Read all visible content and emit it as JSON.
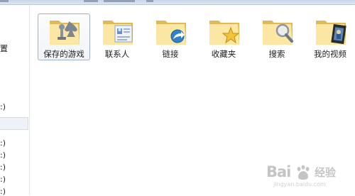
{
  "navigation": {
    "items": [
      "置",
      ":)",
      ":)",
      ":)",
      ":)",
      ":)",
      ":)"
    ]
  },
  "folders": [
    {
      "label": "保存的游戏",
      "icon": "saved-games-folder-icon",
      "selected": true
    },
    {
      "label": "联系人",
      "icon": "contacts-folder-icon",
      "selected": false
    },
    {
      "label": "链接",
      "icon": "links-folder-icon",
      "selected": false
    },
    {
      "label": "收藏夹",
      "icon": "favorites-folder-icon",
      "selected": false
    },
    {
      "label": "搜索",
      "icon": "searches-folder-icon",
      "selected": false
    },
    {
      "label": "我的视频",
      "icon": "my-videos-folder-icon",
      "selected": false
    }
  ],
  "watermark": {
    "logo_text": "Bai",
    "chinese": "经验",
    "site": "jingyan.baidu.com"
  },
  "colors": {
    "folder_light": "#fbe6a4",
    "folder_dark": "#e2b84f",
    "selection_border": "#9fb2c6"
  }
}
